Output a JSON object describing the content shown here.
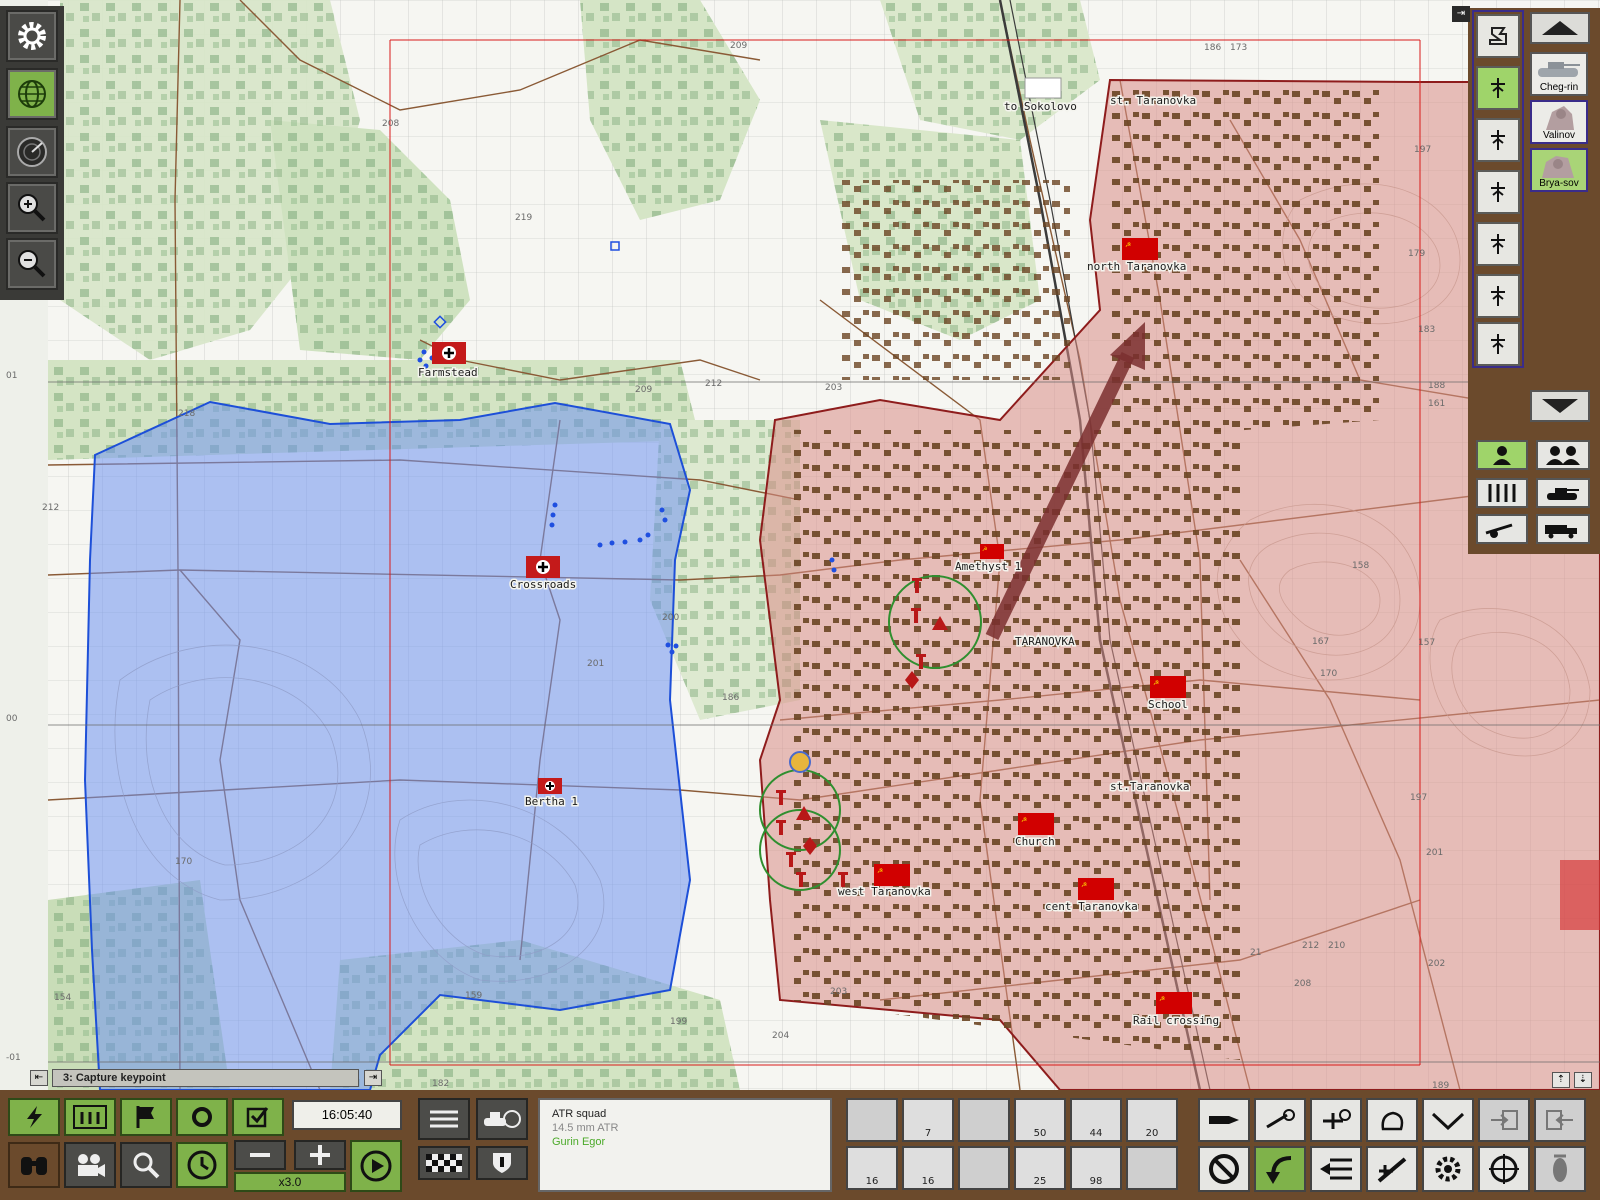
{
  "map": {
    "town_label": "TARANOVKA",
    "place_labels": [
      {
        "id": "to-sokolovo",
        "text": "to Sokolovo"
      },
      {
        "id": "st-taranovka-n",
        "text": "st. Taranovka"
      },
      {
        "id": "st-taranovka-s",
        "text": "st.Taranovka"
      }
    ],
    "grid_labels": [
      "01",
      "00",
      "-01"
    ],
    "contour_labels": [
      "209",
      "208",
      "219",
      "218",
      "212",
      "212",
      "203",
      "209",
      "186",
      "201",
      "200",
      "170",
      "154",
      "159",
      "199",
      "203",
      "204",
      "182",
      "188",
      "161",
      "179",
      "183",
      "197",
      "157",
      "158",
      "167",
      "170",
      "201",
      "202",
      "208",
      "212",
      "210",
      "189",
      "186",
      "173",
      "197",
      "21"
    ]
  },
  "keypoints": [
    {
      "id": "farmstead",
      "name": "Farmstead",
      "side": "german"
    },
    {
      "id": "crossroads",
      "name": "Crossroads",
      "side": "german"
    },
    {
      "id": "bertha1",
      "name": "Bertha 1",
      "side": "german"
    },
    {
      "id": "north-taranovka",
      "name": "north Taranovka",
      "side": "soviet"
    },
    {
      "id": "amethyst1",
      "name": "Amethyst 1",
      "side": "soviet"
    },
    {
      "id": "school",
      "name": "School",
      "side": "soviet"
    },
    {
      "id": "church",
      "name": "Church",
      "side": "soviet"
    },
    {
      "id": "west-taranovka",
      "name": "west Taranovka",
      "side": "soviet"
    },
    {
      "id": "cent-taranovka",
      "name": "cent Taranovka",
      "side": "soviet"
    },
    {
      "id": "rail-crossing",
      "name": "Rail crossing",
      "side": "soviet"
    }
  ],
  "right_panel": {
    "vehicles": [
      {
        "name": "Cheg-rin"
      },
      {
        "name": "Valinov"
      },
      {
        "name": "Brya-sov"
      }
    ]
  },
  "objective": {
    "label": "3: Capture keypoint"
  },
  "time": {
    "clock": "16:05:40",
    "speed": "x3.0"
  },
  "selected_unit": {
    "type": "ATR squad",
    "weapon": "14.5 mm ATR",
    "commander": "Gurin Egor"
  },
  "unit_counts": {
    "top": [
      "",
      "7",
      "",
      "50",
      "44",
      "20"
    ],
    "bottom": [
      "16",
      "16",
      "",
      "25",
      "98",
      ""
    ]
  },
  "colors": {
    "german_zone": "#6f93f0",
    "soviet_zone": "#d98c86",
    "green_ui": "#7fb24a",
    "dark_ui": "#4a4a47",
    "wood": "#6b4a2c",
    "soviet_red": "#c00000",
    "arrow": "#7a2f2f"
  },
  "icons": {
    "left_tools": [
      "gear-icon",
      "globe-icon",
      "radar-icon",
      "zoom-in-icon",
      "zoom-out-icon"
    ]
  }
}
